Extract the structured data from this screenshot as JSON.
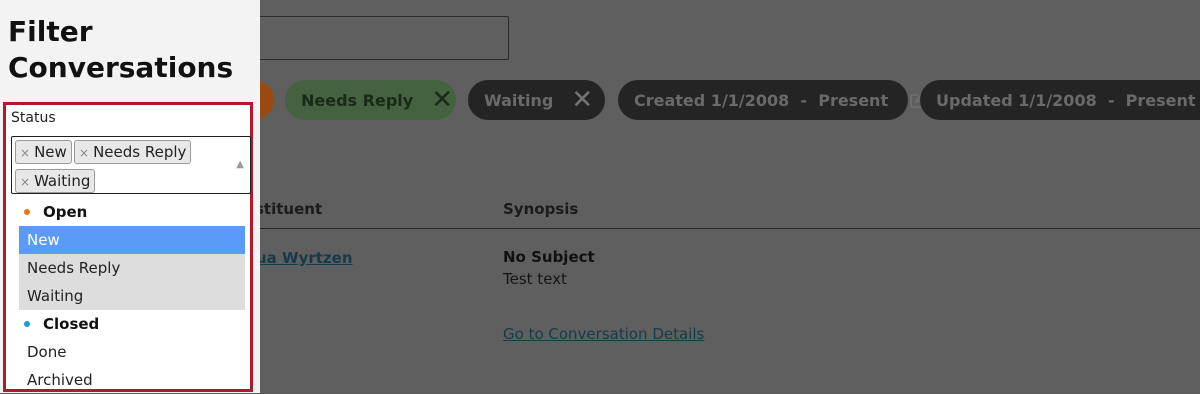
{
  "panel": {
    "title": "Filter Conversations",
    "status_label": "Status",
    "selected_tags": [
      "New",
      "Needs Reply",
      "Waiting"
    ],
    "tag_remove_glyph": "×",
    "dropdown_arrow": "▲",
    "groups": [
      {
        "label": "Open",
        "color": "#e8750f",
        "options": [
          "New",
          "Needs Reply",
          "Waiting"
        ]
      },
      {
        "label": "Closed",
        "color": "#1a9ad6",
        "options": [
          "Done",
          "Archived"
        ]
      }
    ],
    "highlighted_option": "New"
  },
  "background": {
    "chips": [
      {
        "label": "Needs Reply",
        "remove": "✕"
      },
      {
        "label": "Waiting",
        "remove": "✕"
      },
      {
        "label": "Created 1/1/2008  -  Present"
      },
      {
        "label": "Updated 1/1/2008  -  Present"
      }
    ],
    "columns": [
      "stituent",
      "Synopsis"
    ],
    "row": {
      "constituent": "ua Wyrtzen",
      "synopsis_title": "No Subject",
      "synopsis_text": "Test text",
      "details_link": "Go to Conversation Details"
    }
  },
  "colors": {
    "accent_red": "#b3182c",
    "highlight_blue": "#5b9bf8",
    "open_dot": "#e8750f",
    "closed_dot": "#1a9ad6"
  }
}
